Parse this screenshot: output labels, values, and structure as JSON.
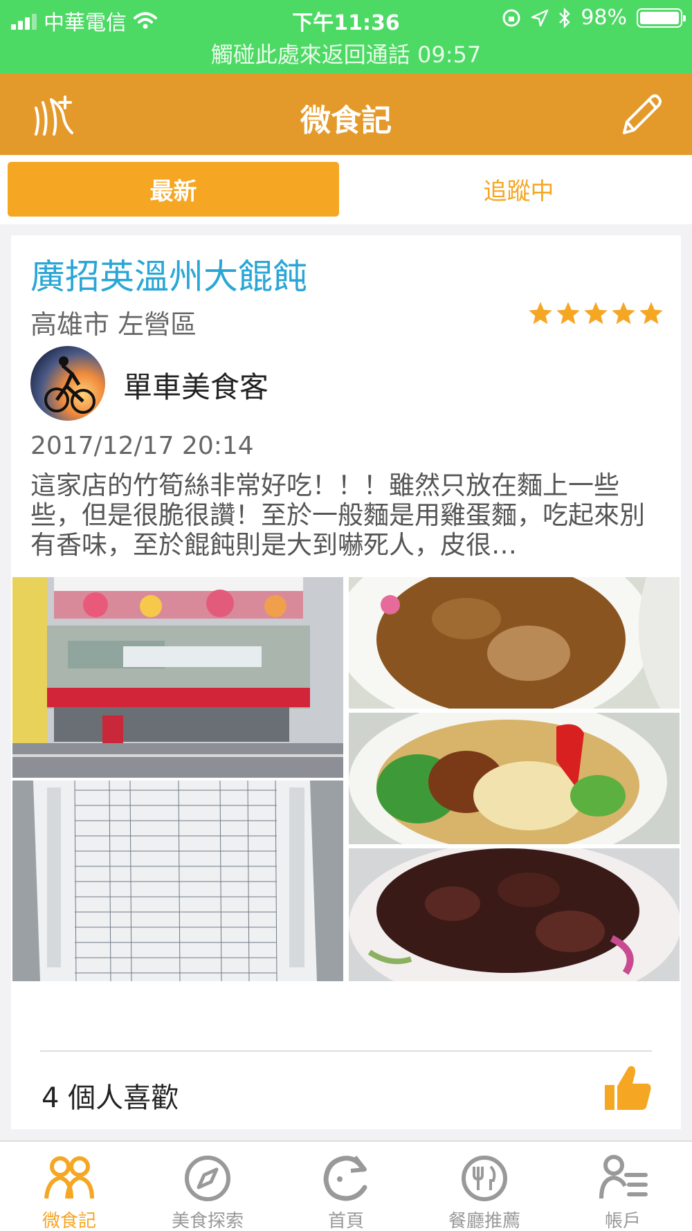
{
  "status_bar": {
    "carrier": "中華電信",
    "time": "下午11:36",
    "battery": "98%",
    "call_banner": "觸碰此處來返回通話 09:57"
  },
  "nav": {
    "title": "微食記"
  },
  "tabs": [
    {
      "label": "最新",
      "active": true
    },
    {
      "label": "追蹤中",
      "active": false
    }
  ],
  "post": {
    "shop_name": "廣招英溫州大餛飩",
    "location": "高雄市 左營區",
    "rating": 5,
    "author": "單車美食客",
    "date": "2017/12/17 20:14",
    "text": "這家店的竹筍絲非常好吃！！！雖然只放在麵上一些些，但是很脆很讚！至於一般麵是用雞蛋麵，吃起來別有香味，至於餛飩則是大到嚇死人，皮很…",
    "likes": "4 個人喜歡"
  },
  "bottom_tabs": [
    {
      "label": "微食記",
      "icon": "people-icon",
      "active": true
    },
    {
      "label": "美食探索",
      "icon": "compass-icon",
      "active": false
    },
    {
      "label": "首頁",
      "icon": "refresh-icon",
      "active": false
    },
    {
      "label": "餐廳推薦",
      "icon": "plate-icon",
      "active": false
    },
    {
      "label": "帳戶",
      "icon": "account-icon",
      "active": false
    }
  ],
  "colors": {
    "status_green": "#4cd964",
    "nav_orange": "#e49a2b",
    "accent_orange": "#f5a623",
    "link_blue": "#2aa6d6"
  }
}
